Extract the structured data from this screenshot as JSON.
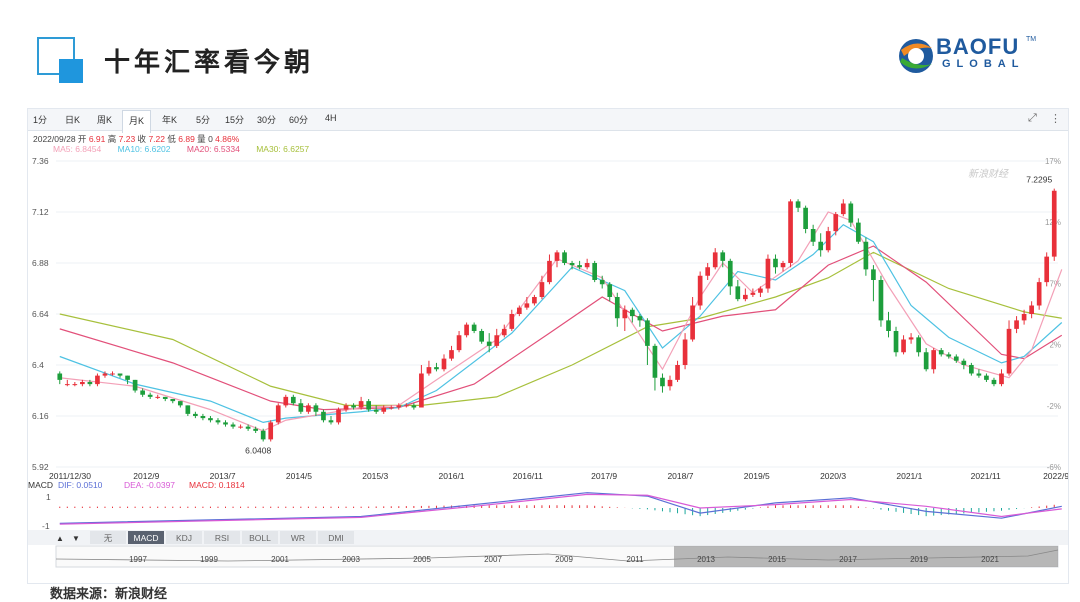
{
  "header": {
    "title": "十年汇率看今朝",
    "brand_name": "BAOFU",
    "brand_tm": "TM",
    "brand_sub": "GLOBAL",
    "brand_colors": [
      "#f08a24",
      "#1f5a9e",
      "#3aaa35"
    ]
  },
  "toolbar": {
    "tabs": [
      "1分",
      "日K",
      "周K",
      "月K",
      "年K",
      "5分",
      "15分",
      "30分",
      "60分",
      "4H"
    ],
    "active_tab": "月K",
    "icons": [
      "fullscreen-icon",
      "more-icon"
    ]
  },
  "info_bar": {
    "date": "2022/09/28",
    "open_label": "开",
    "open": "6.91",
    "high_label": "高",
    "high": "7.23",
    "close_label": "收",
    "close": "7.22",
    "low_label": "低",
    "low": "6.89",
    "volume_label": "量",
    "volume": "0",
    "change": "4.86%"
  },
  "ma_legend": [
    {
      "label": "MA5: 6.8454",
      "color": "#f3a0b7"
    },
    {
      "label": "MA10: 6.6202",
      "color": "#4ec2e3"
    },
    {
      "label": "MA20: 6.5334",
      "color": "#e2507a"
    },
    {
      "label": "MA30: 6.6257",
      "color": "#a7c03c"
    }
  ],
  "chart_data": {
    "type": "candlestick",
    "x_ticks": [
      "2011/12/30",
      "2012/9",
      "2013/7",
      "2014/5",
      "2015/3",
      "2016/1",
      "2016/11",
      "2017/9",
      "2018/7",
      "2019/5",
      "2020/3",
      "2021/1",
      "2021/11",
      "2022/9/28"
    ],
    "y_ticks": [
      "7.36",
      "7.12",
      "6.88",
      "6.64",
      "6.4",
      "6.16",
      "5.92"
    ],
    "ylim": [
      5.92,
      7.36
    ],
    "right_ticks": [
      "17%",
      "12%",
      "7%",
      "2%",
      "-2%",
      "-6%"
    ],
    "annotations": {
      "max_label": "7.2295",
      "min_label": "6.0408"
    },
    "watermark": "新浪财经",
    "up_color": "#e8303a",
    "down_color": "#1d9e3c",
    "candles": [
      [
        6.36,
        6.33,
        6.37,
        6.31
      ],
      [
        6.31,
        6.31,
        6.33,
        6.3
      ],
      [
        6.31,
        6.31,
        6.32,
        6.3
      ],
      [
        6.31,
        6.32,
        6.33,
        6.3
      ],
      [
        6.32,
        6.31,
        6.33,
        6.3
      ],
      [
        6.31,
        6.35,
        6.36,
        6.3
      ],
      [
        6.35,
        6.36,
        6.37,
        6.34
      ],
      [
        6.36,
        6.36,
        6.37,
        6.35
      ],
      [
        6.36,
        6.35,
        6.36,
        6.34
      ],
      [
        6.35,
        6.33,
        6.35,
        6.31
      ],
      [
        6.33,
        6.28,
        6.33,
        6.27
      ],
      [
        6.28,
        6.26,
        6.29,
        6.25
      ],
      [
        6.26,
        6.25,
        6.27,
        6.24
      ],
      [
        6.25,
        6.25,
        6.26,
        6.24
      ],
      [
        6.25,
        6.24,
        6.25,
        6.23
      ],
      [
        6.24,
        6.23,
        6.24,
        6.22
      ],
      [
        6.23,
        6.21,
        6.23,
        6.2
      ],
      [
        6.21,
        6.17,
        6.21,
        6.16
      ],
      [
        6.17,
        6.16,
        6.18,
        6.15
      ],
      [
        6.16,
        6.15,
        6.17,
        6.14
      ],
      [
        6.15,
        6.14,
        6.16,
        6.13
      ],
      [
        6.14,
        6.13,
        6.15,
        6.12
      ],
      [
        6.13,
        6.12,
        6.14,
        6.11
      ],
      [
        6.12,
        6.11,
        6.13,
        6.1
      ],
      [
        6.11,
        6.11,
        6.12,
        6.1
      ],
      [
        6.11,
        6.1,
        6.12,
        6.09
      ],
      [
        6.1,
        6.09,
        6.11,
        6.08
      ],
      [
        6.09,
        6.05,
        6.1,
        6.04
      ],
      [
        6.05,
        6.13,
        6.14,
        6.04
      ],
      [
        6.13,
        6.21,
        6.22,
        6.12
      ],
      [
        6.21,
        6.25,
        6.26,
        6.2
      ],
      [
        6.25,
        6.22,
        6.26,
        6.21
      ],
      [
        6.22,
        6.18,
        6.24,
        6.17
      ],
      [
        6.18,
        6.21,
        6.22,
        6.17
      ],
      [
        6.21,
        6.18,
        6.22,
        6.16
      ],
      [
        6.18,
        6.14,
        6.19,
        6.13
      ],
      [
        6.14,
        6.13,
        6.16,
        6.12
      ],
      [
        6.13,
        6.19,
        6.2,
        6.12
      ],
      [
        6.19,
        6.21,
        6.22,
        6.18
      ],
      [
        6.21,
        6.2,
        6.22,
        6.19
      ],
      [
        6.2,
        6.23,
        6.25,
        6.19
      ],
      [
        6.23,
        6.19,
        6.24,
        6.18
      ],
      [
        6.19,
        6.18,
        6.21,
        6.17
      ],
      [
        6.18,
        6.2,
        6.21,
        6.17
      ],
      [
        6.2,
        6.2,
        6.21,
        6.19
      ],
      [
        6.2,
        6.21,
        6.22,
        6.19
      ],
      [
        6.21,
        6.21,
        6.22,
        6.2
      ],
      [
        6.21,
        6.2,
        6.22,
        6.19
      ],
      [
        6.2,
        6.36,
        6.4,
        6.2
      ],
      [
        6.36,
        6.39,
        6.42,
        6.35
      ],
      [
        6.39,
        6.38,
        6.41,
        6.37
      ],
      [
        6.38,
        6.43,
        6.45,
        6.37
      ],
      [
        6.43,
        6.47,
        6.49,
        6.42
      ],
      [
        6.47,
        6.54,
        6.56,
        6.46
      ],
      [
        6.54,
        6.59,
        6.6,
        6.53
      ],
      [
        6.59,
        6.56,
        6.6,
        6.55
      ],
      [
        6.56,
        6.51,
        6.57,
        6.5
      ],
      [
        6.51,
        6.49,
        6.55,
        6.46
      ],
      [
        6.49,
        6.54,
        6.57,
        6.48
      ],
      [
        6.54,
        6.57,
        6.59,
        6.53
      ],
      [
        6.57,
        6.64,
        6.66,
        6.56
      ],
      [
        6.64,
        6.67,
        6.68,
        6.63
      ],
      [
        6.67,
        6.69,
        6.72,
        6.66
      ],
      [
        6.69,
        6.72,
        6.73,
        6.68
      ],
      [
        6.72,
        6.79,
        6.82,
        6.71
      ],
      [
        6.79,
        6.89,
        6.92,
        6.78
      ],
      [
        6.89,
        6.93,
        6.94,
        6.86
      ],
      [
        6.93,
        6.88,
        6.94,
        6.87
      ],
      [
        6.88,
        6.87,
        6.89,
        6.85
      ],
      [
        6.87,
        6.86,
        6.89,
        6.85
      ],
      [
        6.86,
        6.88,
        6.9,
        6.85
      ],
      [
        6.88,
        6.8,
        6.89,
        6.79
      ],
      [
        6.8,
        6.78,
        6.82,
        6.76
      ],
      [
        6.78,
        6.72,
        6.79,
        6.7
      ],
      [
        6.72,
        6.62,
        6.74,
        6.58
      ],
      [
        6.62,
        6.66,
        6.68,
        6.56
      ],
      [
        6.66,
        6.63,
        6.67,
        6.6
      ],
      [
        6.63,
        6.61,
        6.64,
        6.58
      ],
      [
        6.61,
        6.49,
        6.62,
        6.4
      ],
      [
        6.49,
        6.34,
        6.5,
        6.28
      ],
      [
        6.34,
        6.3,
        6.36,
        6.27
      ],
      [
        6.3,
        6.33,
        6.35,
        6.28
      ],
      [
        6.33,
        6.4,
        6.42,
        6.32
      ],
      [
        6.4,
        6.52,
        6.55,
        6.38
      ],
      [
        6.52,
        6.68,
        6.72,
        6.51
      ],
      [
        6.68,
        6.82,
        6.84,
        6.66
      ],
      [
        6.82,
        6.86,
        6.88,
        6.8
      ],
      [
        6.86,
        6.93,
        6.95,
        6.85
      ],
      [
        6.93,
        6.89,
        6.94,
        6.86
      ],
      [
        6.89,
        6.77,
        6.9,
        6.73
      ],
      [
        6.77,
        6.71,
        6.8,
        6.7
      ],
      [
        6.71,
        6.73,
        6.76,
        6.7
      ],
      [
        6.73,
        6.74,
        6.76,
        6.72
      ],
      [
        6.74,
        6.76,
        6.77,
        6.72
      ],
      [
        6.76,
        6.9,
        6.92,
        6.74
      ],
      [
        6.9,
        6.86,
        6.92,
        6.83
      ],
      [
        6.86,
        6.88,
        6.89,
        6.84
      ],
      [
        6.88,
        7.17,
        7.18,
        6.86
      ],
      [
        7.17,
        7.14,
        7.18,
        7.12
      ],
      [
        7.14,
        7.04,
        7.15,
        7.02
      ],
      [
        7.04,
        6.98,
        7.06,
        6.96
      ],
      [
        6.98,
        6.94,
        7.02,
        6.91
      ],
      [
        6.94,
        7.03,
        7.05,
        6.93
      ],
      [
        7.03,
        7.11,
        7.12,
        7.01
      ],
      [
        7.11,
        7.16,
        7.18,
        7.1
      ],
      [
        7.16,
        7.07,
        7.17,
        7.05
      ],
      [
        7.07,
        6.98,
        7.09,
        6.97
      ],
      [
        6.98,
        6.85,
        7.0,
        6.82
      ],
      [
        6.85,
        6.8,
        6.87,
        6.7
      ],
      [
        6.8,
        6.61,
        6.82,
        6.58
      ],
      [
        6.61,
        6.56,
        6.65,
        6.53
      ],
      [
        6.56,
        6.46,
        6.58,
        6.44
      ],
      [
        6.46,
        6.52,
        6.54,
        6.45
      ],
      [
        6.52,
        6.53,
        6.55,
        6.5
      ],
      [
        6.53,
        6.46,
        6.54,
        6.44
      ],
      [
        6.46,
        6.38,
        6.48,
        6.37
      ],
      [
        6.38,
        6.47,
        6.48,
        6.36
      ],
      [
        6.47,
        6.45,
        6.48,
        6.44
      ],
      [
        6.45,
        6.44,
        6.46,
        6.43
      ],
      [
        6.44,
        6.42,
        6.45,
        6.41
      ],
      [
        6.42,
        6.4,
        6.43,
        6.38
      ],
      [
        6.4,
        6.36,
        6.41,
        6.35
      ],
      [
        6.36,
        6.35,
        6.38,
        6.34
      ],
      [
        6.35,
        6.33,
        6.36,
        6.32
      ],
      [
        6.33,
        6.31,
        6.34,
        6.3
      ],
      [
        6.31,
        6.36,
        6.38,
        6.3
      ],
      [
        6.36,
        6.57,
        6.61,
        6.35
      ],
      [
        6.57,
        6.61,
        6.63,
        6.55
      ],
      [
        6.61,
        6.64,
        6.66,
        6.59
      ],
      [
        6.64,
        6.68,
        6.7,
        6.62
      ],
      [
        6.68,
        6.79,
        6.81,
        6.66
      ],
      [
        6.79,
        6.91,
        6.93,
        6.77
      ],
      [
        6.91,
        7.22,
        7.23,
        6.89
      ]
    ],
    "lines": [
      {
        "name": "MA30",
        "color": "#a7c03c",
        "points": [
          [
            0,
            6.64
          ],
          [
            15,
            6.52
          ],
          [
            28,
            6.3
          ],
          [
            38,
            6.21
          ],
          [
            48,
            6.21
          ],
          [
            58,
            6.25
          ],
          [
            68,
            6.4
          ],
          [
            78,
            6.58
          ],
          [
            85,
            6.62
          ],
          [
            95,
            6.72
          ],
          [
            102,
            6.81
          ],
          [
            108,
            6.93
          ],
          [
            118,
            6.76
          ],
          [
            128,
            6.65
          ],
          [
            133,
            6.62
          ]
        ]
      },
      {
        "name": "MA20",
        "color": "#e2507a",
        "points": [
          [
            0,
            6.57
          ],
          [
            15,
            6.41
          ],
          [
            28,
            6.23
          ],
          [
            35,
            6.19
          ],
          [
            45,
            6.2
          ],
          [
            55,
            6.31
          ],
          [
            65,
            6.55
          ],
          [
            72,
            6.72
          ],
          [
            80,
            6.56
          ],
          [
            88,
            6.63
          ],
          [
            95,
            6.66
          ],
          [
            102,
            6.87
          ],
          [
            108,
            6.96
          ],
          [
            115,
            6.79
          ],
          [
            125,
            6.45
          ],
          [
            128,
            6.43
          ],
          [
            133,
            6.54
          ]
        ]
      },
      {
        "name": "MA10",
        "color": "#4ec2e3",
        "points": [
          [
            0,
            6.44
          ],
          [
            10,
            6.31
          ],
          [
            20,
            6.23
          ],
          [
            27,
            6.13
          ],
          [
            30,
            6.15
          ],
          [
            40,
            6.18
          ],
          [
            45,
            6.2
          ],
          [
            50,
            6.28
          ],
          [
            60,
            6.55
          ],
          [
            68,
            6.86
          ],
          [
            75,
            6.75
          ],
          [
            80,
            6.48
          ],
          [
            85,
            6.63
          ],
          [
            90,
            6.84
          ],
          [
            95,
            6.8
          ],
          [
            100,
            6.92
          ],
          [
            104,
            7.06
          ],
          [
            108,
            6.98
          ],
          [
            113,
            6.68
          ],
          [
            118,
            6.53
          ],
          [
            125,
            6.41
          ],
          [
            128,
            6.44
          ],
          [
            133,
            6.6
          ]
        ]
      },
      {
        "name": "MA5",
        "color": "#f3a0b7",
        "points": [
          [
            0,
            6.34
          ],
          [
            10,
            6.3
          ],
          [
            20,
            6.19
          ],
          [
            27,
            6.09
          ],
          [
            30,
            6.14
          ],
          [
            40,
            6.2
          ],
          [
            45,
            6.21
          ],
          [
            50,
            6.33
          ],
          [
            58,
            6.52
          ],
          [
            66,
            6.9
          ],
          [
            72,
            6.81
          ],
          [
            80,
            6.38
          ],
          [
            85,
            6.72
          ],
          [
            88,
            6.88
          ],
          [
            92,
            6.74
          ],
          [
            98,
            6.89
          ],
          [
            102,
            7.12
          ],
          [
            105,
            7.08
          ],
          [
            110,
            6.77
          ],
          [
            115,
            6.5
          ],
          [
            120,
            6.4
          ],
          [
            126,
            6.34
          ],
          [
            129,
            6.47
          ],
          [
            133,
            6.85
          ]
        ]
      }
    ],
    "macd": {
      "label": "MACD",
      "dif": "DIF: 0.0510",
      "dea": "DEA: -0.0397",
      "macd": "MACD: 0.1814",
      "y_ticks": [
        "1",
        "-1"
      ],
      "tabs": [
        "无",
        "MACD",
        "KDJ",
        "RSI",
        "BOLL",
        "WR",
        "DMI"
      ],
      "active": "MACD",
      "dif_color": "#5b6fd6",
      "dea_color": "#d85ad6",
      "dif_points": [
        [
          0,
          -0.9
        ],
        [
          20,
          -0.7
        ],
        [
          40,
          -0.5
        ],
        [
          55,
          0.2
        ],
        [
          70,
          0.9
        ],
        [
          78,
          0.7
        ],
        [
          85,
          -0.3
        ],
        [
          95,
          0.3
        ],
        [
          105,
          0.6
        ],
        [
          115,
          -0.2
        ],
        [
          125,
          -0.6
        ],
        [
          133,
          0.1
        ]
      ],
      "dea_points": [
        [
          0,
          -0.95
        ],
        [
          20,
          -0.75
        ],
        [
          40,
          -0.55
        ],
        [
          55,
          0.1
        ],
        [
          70,
          0.8
        ],
        [
          78,
          0.75
        ],
        [
          85,
          0.0
        ],
        [
          95,
          0.2
        ],
        [
          105,
          0.5
        ],
        [
          115,
          0.1
        ],
        [
          125,
          -0.5
        ],
        [
          133,
          -0.05
        ]
      ]
    },
    "navigator_labels": [
      "1997",
      "1999",
      "2001",
      "2003",
      "2005",
      "2007",
      "2009",
      "2011",
      "2013",
      "2015",
      "2017",
      "2019",
      "2021"
    ],
    "nav_arrows": [
      "▲",
      "▼"
    ]
  },
  "footer": {
    "source": "数据来源：新浪财经"
  }
}
